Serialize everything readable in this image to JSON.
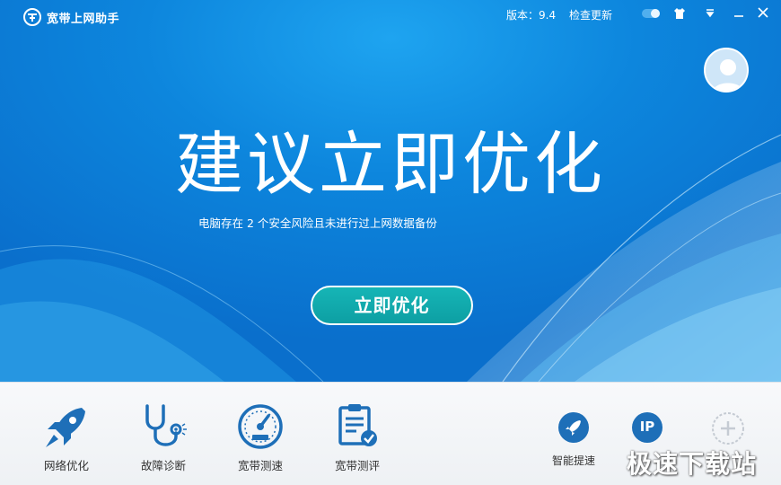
{
  "titlebar": {
    "app_title": "宽带上网助手",
    "version": "版本：9.4",
    "check_update": "检查更新"
  },
  "hero": {
    "headline": "建议立即优化",
    "subline": "电脑存在 2 个安全风险且未进行过上网数据备份",
    "cta_label": "立即优化"
  },
  "tools": [
    {
      "label": "网络优化",
      "icon": "rocket-icon"
    },
    {
      "label": "故障诊断",
      "icon": "stethoscope-icon"
    },
    {
      "label": "宽带测速",
      "icon": "speedometer-icon"
    },
    {
      "label": "宽带测评",
      "icon": "clipboard-check-icon"
    }
  ],
  "mini_tools": [
    {
      "label": "智能提速",
      "icon": "rocket-circle-icon"
    },
    {
      "label": "IP",
      "icon": "ip-circle-icon"
    },
    {
      "label": "",
      "icon": "add-circle-icon"
    }
  ],
  "watermark": "极速下载站",
  "colors": {
    "accent_blue": "#0d86dd",
    "tool_blue": "#1e6fb8",
    "cta_teal": "#0d9fa3"
  }
}
